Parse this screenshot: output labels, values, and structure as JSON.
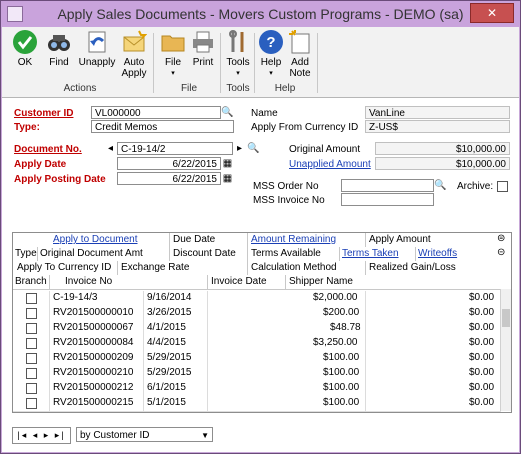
{
  "window": {
    "title": "Apply Sales Documents  -  Movers Custom Programs  -  DEMO (sa)",
    "close": "✕"
  },
  "ribbon": {
    "buttons": {
      "ok": "OK",
      "find": "Find",
      "unapply": "Unapply",
      "auto_apply_1": "Auto",
      "auto_apply_2": "Apply",
      "file": "File",
      "print": "Print",
      "tools": "Tools",
      "help": "Help",
      "add_note_1": "Add",
      "add_note_2": "Note"
    },
    "groups": {
      "actions": "Actions",
      "file": "File",
      "tools": "Tools",
      "help": "Help"
    },
    "colors": {
      "ok": "#2aa33a",
      "help": "#2a5fbf"
    }
  },
  "form": {
    "customer_id_label": "Customer ID",
    "customer_id": "VL000000",
    "type_label": "Type:",
    "type": "Credit Memos",
    "document_no_label": "Document No.",
    "document_no": "C-19-14/2",
    "apply_date_label": "Apply Date",
    "apply_date": "6/22/2015",
    "apply_posting_date_label": "Apply Posting Date",
    "apply_posting_date": "6/22/2015",
    "name_label": "Name",
    "name": "VanLine",
    "currency_label": "Apply From Currency ID",
    "currency": "Z-US$",
    "original_amount_label": "Original Amount",
    "original_amount": "$10,000.00",
    "unapplied_amount_label": "Unapplied Amount",
    "unapplied_amount": "$10,000.00",
    "mss_order_label": "MSS Order No",
    "mss_order": "",
    "archive_label": "Archive:",
    "mss_invoice_label": "MSS Invoice No",
    "mss_invoice": ""
  },
  "grid": {
    "header_row1": {
      "apply_to_document": "Apply to Document",
      "due_date": "Due Date",
      "amount_remaining": "Amount Remaining",
      "apply_amount": "Apply Amount"
    },
    "header_row2": {
      "type": "Type",
      "original_doc_amt": "Original Document Amt",
      "discount_date": "Discount Date",
      "terms_available": "Terms Available",
      "terms_taken": "Terms Taken",
      "writeoffs": "Writeoffs"
    },
    "header_row3": {
      "apply_to_currency": "Apply To Currency ID",
      "exchange_rate": "Exchange Rate",
      "calculation_method": "Calculation Method",
      "realized_gain_loss": "Realized Gain/Loss"
    },
    "header_row4": {
      "branch": "Branch",
      "invoice_no": "Invoice No",
      "invoice_date": "Invoice Date",
      "shipper_name": "Shipper Name"
    },
    "rows": [
      {
        "invoice_no": "C-19-14/3",
        "date": "9/16/2014",
        "shipper": "$2,000.00",
        "amount": "$0.00"
      },
      {
        "invoice_no": "RV201500000010",
        "date": "3/26/2015",
        "shipper": "$200.00",
        "amount": "$0.00"
      },
      {
        "invoice_no": "RV201500000067",
        "date": "4/1/2015",
        "shipper": "$48.78",
        "amount": "$0.00"
      },
      {
        "invoice_no": "RV201500000084",
        "date": "4/4/2015",
        "shipper": "$3,250.00",
        "amount": "$0.00"
      },
      {
        "invoice_no": "RV201500000209",
        "date": "5/29/2015",
        "shipper": "$100.00",
        "amount": "$0.00"
      },
      {
        "invoice_no": "RV201500000210",
        "date": "5/29/2015",
        "shipper": "$100.00",
        "amount": "$0.00"
      },
      {
        "invoice_no": "RV201500000212",
        "date": "6/1/2015",
        "shipper": "$100.00",
        "amount": "$0.00"
      },
      {
        "invoice_no": "RV201500000215",
        "date": "5/1/2015",
        "shipper": "$100.00",
        "amount": "$0.00"
      }
    ]
  },
  "footer": {
    "nav": "|◂ ◂ ▸ ▸|",
    "sort_by": "by Customer ID"
  }
}
